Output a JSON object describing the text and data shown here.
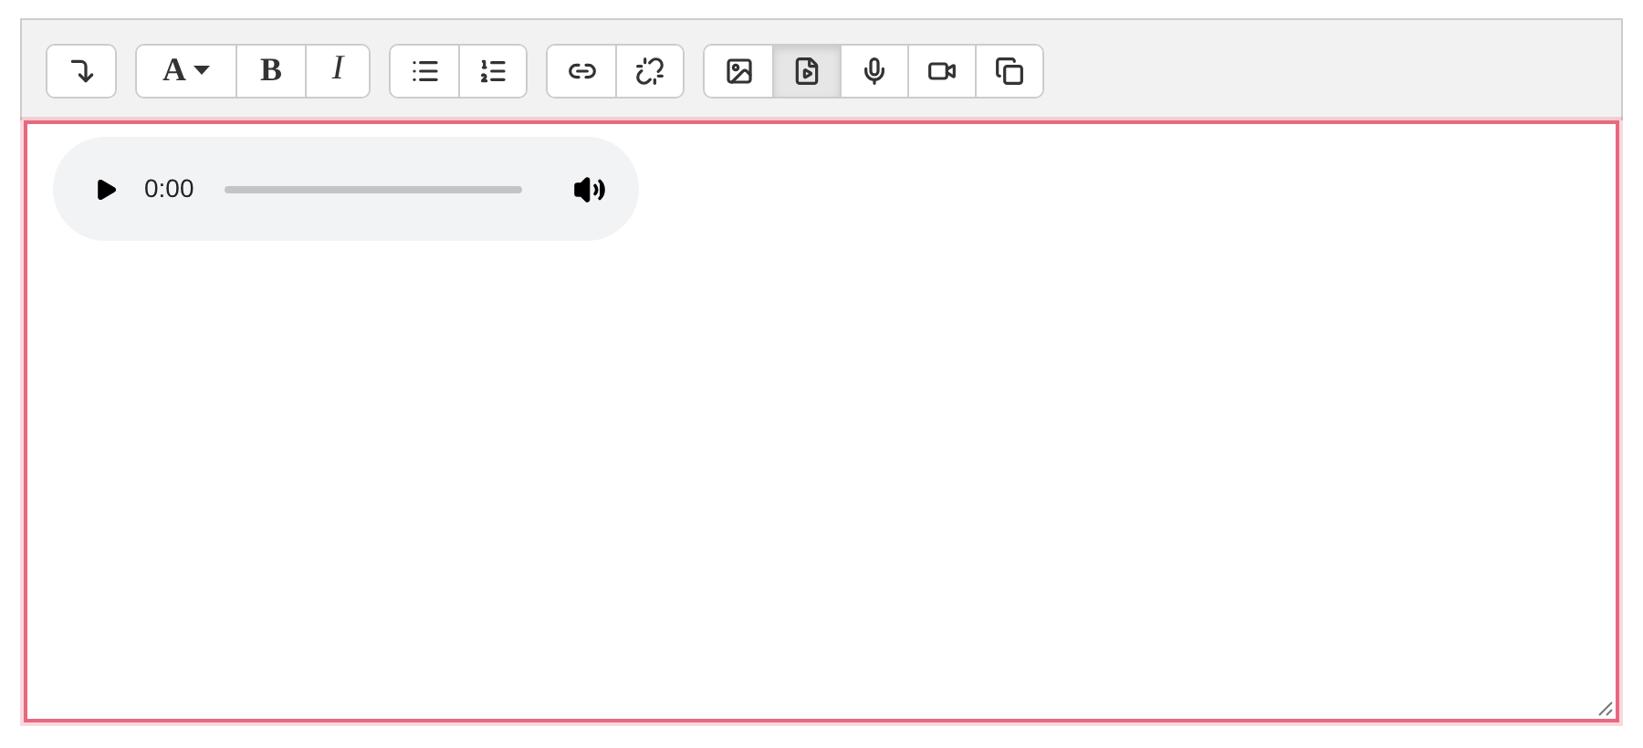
{
  "toolbar": {
    "groups": [
      {
        "buttons": [
          {
            "kind": "collapse",
            "selected": false
          }
        ]
      },
      {
        "buttons": [
          {
            "kind": "font",
            "label": "A",
            "selected": false
          },
          {
            "kind": "bold",
            "label": "B",
            "selected": false
          },
          {
            "kind": "italic",
            "label": "I",
            "selected": false
          }
        ]
      },
      {
        "buttons": [
          {
            "kind": "bullets",
            "selected": false
          },
          {
            "kind": "numbers",
            "selected": false
          }
        ]
      },
      {
        "buttons": [
          {
            "kind": "link",
            "selected": false
          },
          {
            "kind": "unlink",
            "selected": false
          }
        ]
      },
      {
        "buttons": [
          {
            "kind": "image",
            "selected": false
          },
          {
            "kind": "media",
            "selected": true
          },
          {
            "kind": "mic",
            "selected": false
          },
          {
            "kind": "video",
            "selected": false
          },
          {
            "kind": "files",
            "selected": false
          }
        ]
      }
    ]
  },
  "editor": {
    "audio_player": {
      "time": "0:00"
    }
  }
}
